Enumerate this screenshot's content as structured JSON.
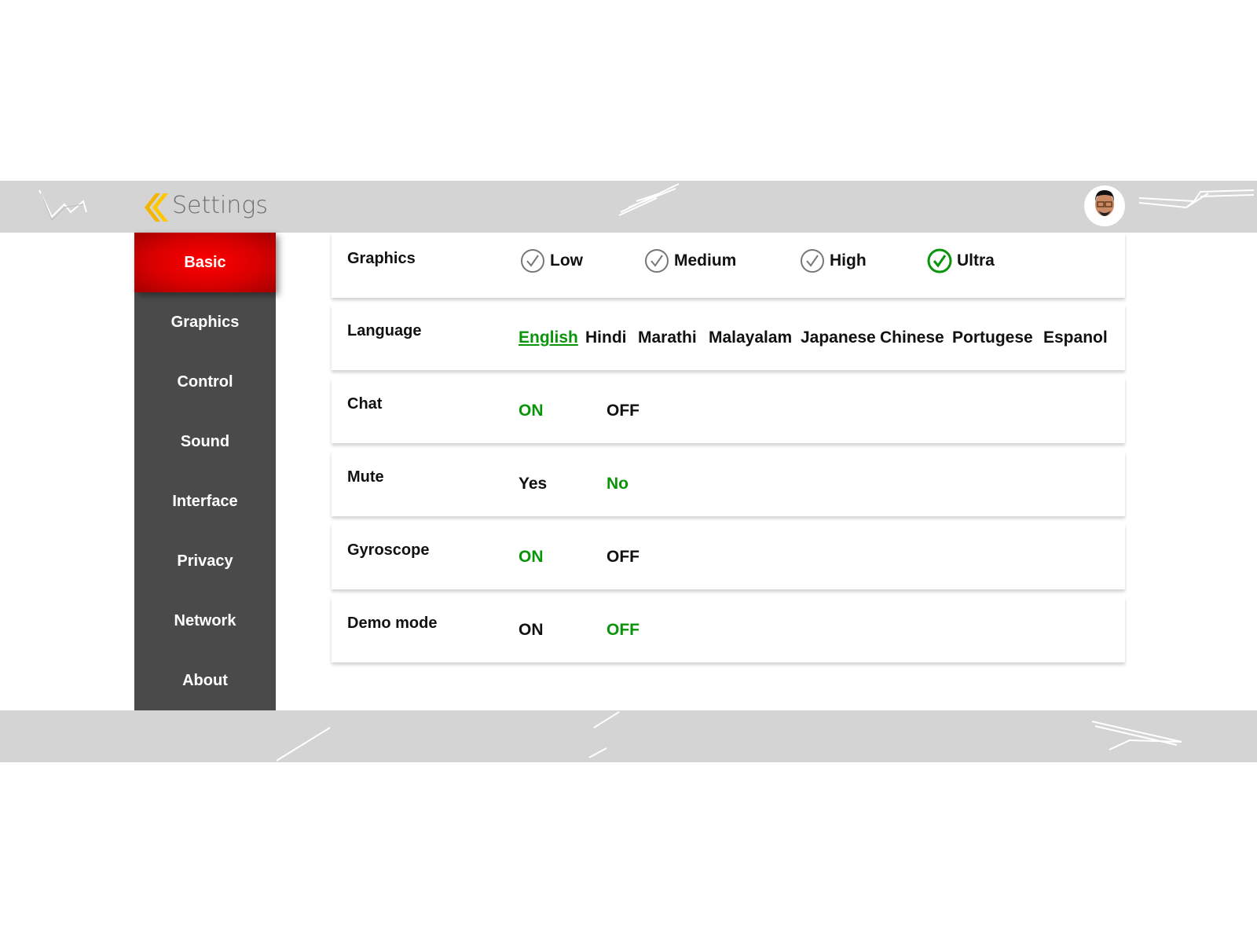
{
  "header": {
    "title": "Settings"
  },
  "sidebar": {
    "items": [
      {
        "label": "Basic",
        "active": true
      },
      {
        "label": "Graphics"
      },
      {
        "label": "Control"
      },
      {
        "label": "Sound"
      },
      {
        "label": "Interface"
      },
      {
        "label": "Privacy"
      },
      {
        "label": "Network"
      },
      {
        "label": "About"
      }
    ]
  },
  "settings": {
    "graphics": {
      "label": "Graphics",
      "options": [
        "Low",
        "Medium",
        "High",
        "Ultra"
      ],
      "selected": "Ultra"
    },
    "language": {
      "label": "Language",
      "options": [
        "English",
        "Hindi",
        "Marathi",
        "Malayalam",
        "Japanese",
        "Chinese",
        "Portugese",
        "Espanol"
      ],
      "selected": "English"
    },
    "chat": {
      "label": "Chat",
      "options": [
        "ON",
        "OFF"
      ],
      "selected": "ON"
    },
    "mute": {
      "label": "Mute",
      "options": [
        "Yes",
        "No"
      ],
      "selected": "No"
    },
    "gyroscope": {
      "label": "Gyroscope",
      "options": [
        "ON",
        "OFF"
      ],
      "selected": "ON"
    },
    "demo": {
      "label": "Demo mode",
      "options": [
        "ON",
        "OFF"
      ],
      "selected": "OFF"
    }
  },
  "colors": {
    "accent": "#0a940a",
    "active_tab": "#e00000",
    "sidebar": "#4a4a4a",
    "bar": "#d4d4d4"
  }
}
